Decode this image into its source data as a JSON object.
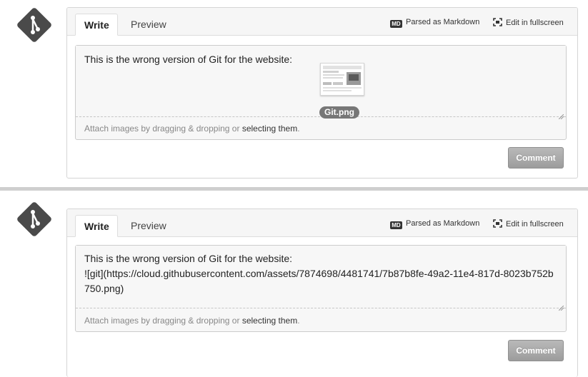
{
  "panels": [
    {
      "tabs": {
        "write": "Write",
        "preview": "Preview"
      },
      "markdown_hint": "Parsed as Markdown",
      "markdown_badge": "MD",
      "fullscreen_label": "Edit in fullscreen",
      "textarea_value": "This is the wrong version of Git for the website:",
      "attachment": {
        "filename": "Git.png"
      },
      "attach_hint": {
        "prefix": "Attach images by dragging & dropping or ",
        "link": "selecting them",
        "suffix": "."
      },
      "submit_label": "Comment"
    },
    {
      "tabs": {
        "write": "Write",
        "preview": "Preview"
      },
      "markdown_hint": "Parsed as Markdown",
      "markdown_badge": "MD",
      "fullscreen_label": "Edit in fullscreen",
      "textarea_value": "This is the wrong version of Git for the website:\n![git](https://cloud.githubusercontent.com/assets/7874698/4481741/7b87b8fe-49a2-11e4-817d-8023b752b750.png)",
      "attach_hint": {
        "prefix": "Attach images by dragging & dropping or ",
        "link": "selecting them",
        "suffix": "."
      },
      "submit_label": "Comment"
    }
  ],
  "colors": {
    "avatar": "#4a4a4a",
    "tabbar_bg": "#f6f6f6",
    "editor_bg": "#f7f7f7",
    "button": "#a8a8a8",
    "divider": "#cfcfcf"
  },
  "icons": {
    "avatar": "git-logo-icon",
    "markdown": "markdown-icon",
    "fullscreen": "fullscreen-icon",
    "resize": "resize-grip-icon"
  }
}
